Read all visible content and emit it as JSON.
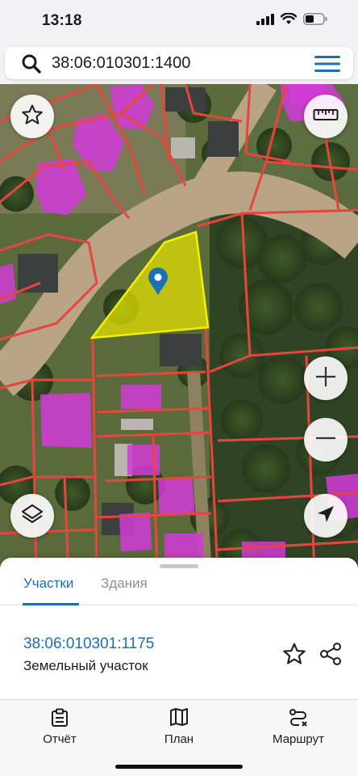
{
  "status_bar": {
    "time": "13:18",
    "icons": [
      "cellular-signal-icon",
      "wifi-icon",
      "battery-icon"
    ]
  },
  "search": {
    "value": "38:06:010301:1400",
    "icons": [
      "search-icon",
      "menu-icon"
    ]
  },
  "map": {
    "controls": [
      "star-icon",
      "ruler-icon",
      "zoom-in-icon",
      "zoom-out-icon",
      "layers-icon",
      "location-arrow-icon"
    ],
    "selected_parcel_color": "#e6e600",
    "boundary_color": "#e8453c",
    "building_color": "#d23bd8"
  },
  "sheet": {
    "tabs": [
      {
        "label": "Участки",
        "active": true
      },
      {
        "label": "Здания",
        "active": false
      }
    ],
    "parcel": {
      "number": "38:06:010301:1175",
      "type": "Земельный участок"
    },
    "actions": [
      "star-outline-icon",
      "share-icon"
    ]
  },
  "tabbar": [
    {
      "label": "Отчёт",
      "icon": "report-icon"
    },
    {
      "label": "План",
      "icon": "map-book-icon"
    },
    {
      "label": "Маршрут",
      "icon": "route-icon"
    }
  ],
  "colors": {
    "accent": "#1a6fb5"
  }
}
